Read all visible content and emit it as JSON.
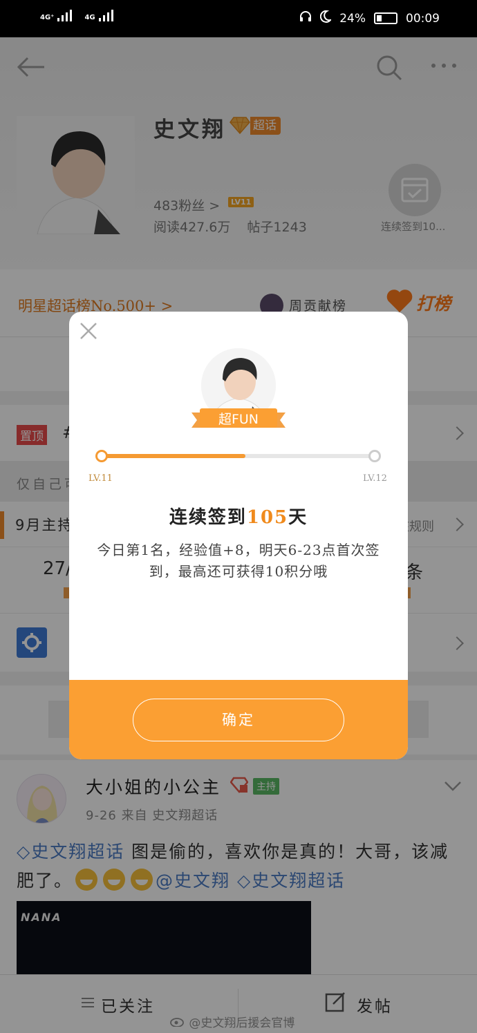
{
  "status_bar": {
    "network_1": "4G⁺",
    "network_2": "4G",
    "battery_pct": "24%",
    "time": "00:09"
  },
  "header": {
    "title": "史文翔",
    "super_tag": "超话",
    "fans": "483粉丝 >",
    "level_badge": "LV11",
    "reads": "阅读427.6万 帖子1243",
    "checkin_label": "连续签到10..."
  },
  "rank": {
    "rank_text": "明星超话榜No.500+ >",
    "weekly_text": "周贡献榜",
    "vote_label": "打榜"
  },
  "pinned": {
    "tag": "置顶",
    "prefix": "#"
  },
  "visibility_row": {
    "text": "仅自己可"
  },
  "host_row": {
    "text": "9月主持",
    "right_text": "核规则"
  },
  "stat_row": {
    "left": "27/",
    "right": "条"
  },
  "post": {
    "username": "大小姐的小公主",
    "host_tag": "主持",
    "meta": "9-26  来自 史文翔超话",
    "topic_1": "◇史文翔超话",
    "text_1": " 图是偷的，喜欢你是真的！大哥，该减肥了。",
    "mention": "@史文翔",
    "topic_2": " ◇史文翔超话",
    "image_caption": "NANA"
  },
  "bottom_bar": {
    "follow_label": "已关注",
    "post_label": "发帖"
  },
  "watermark": "@史文翔后援会官博",
  "modal": {
    "ribbon": "超FUN",
    "level_start": "LV.11",
    "level_end": "LV.12",
    "progress": 0.53,
    "headline_pre": "连续签到",
    "headline_num": "105",
    "headline_post": "天",
    "description": "今日第1名，经验值+8，明天6-23点首次签到，最高还可获得10积分哦",
    "confirm_label": "确定"
  },
  "colors": {
    "accent": "#fb9f33",
    "rank_orange": "#e07a1f",
    "topic_blue": "#4a7bc4"
  }
}
